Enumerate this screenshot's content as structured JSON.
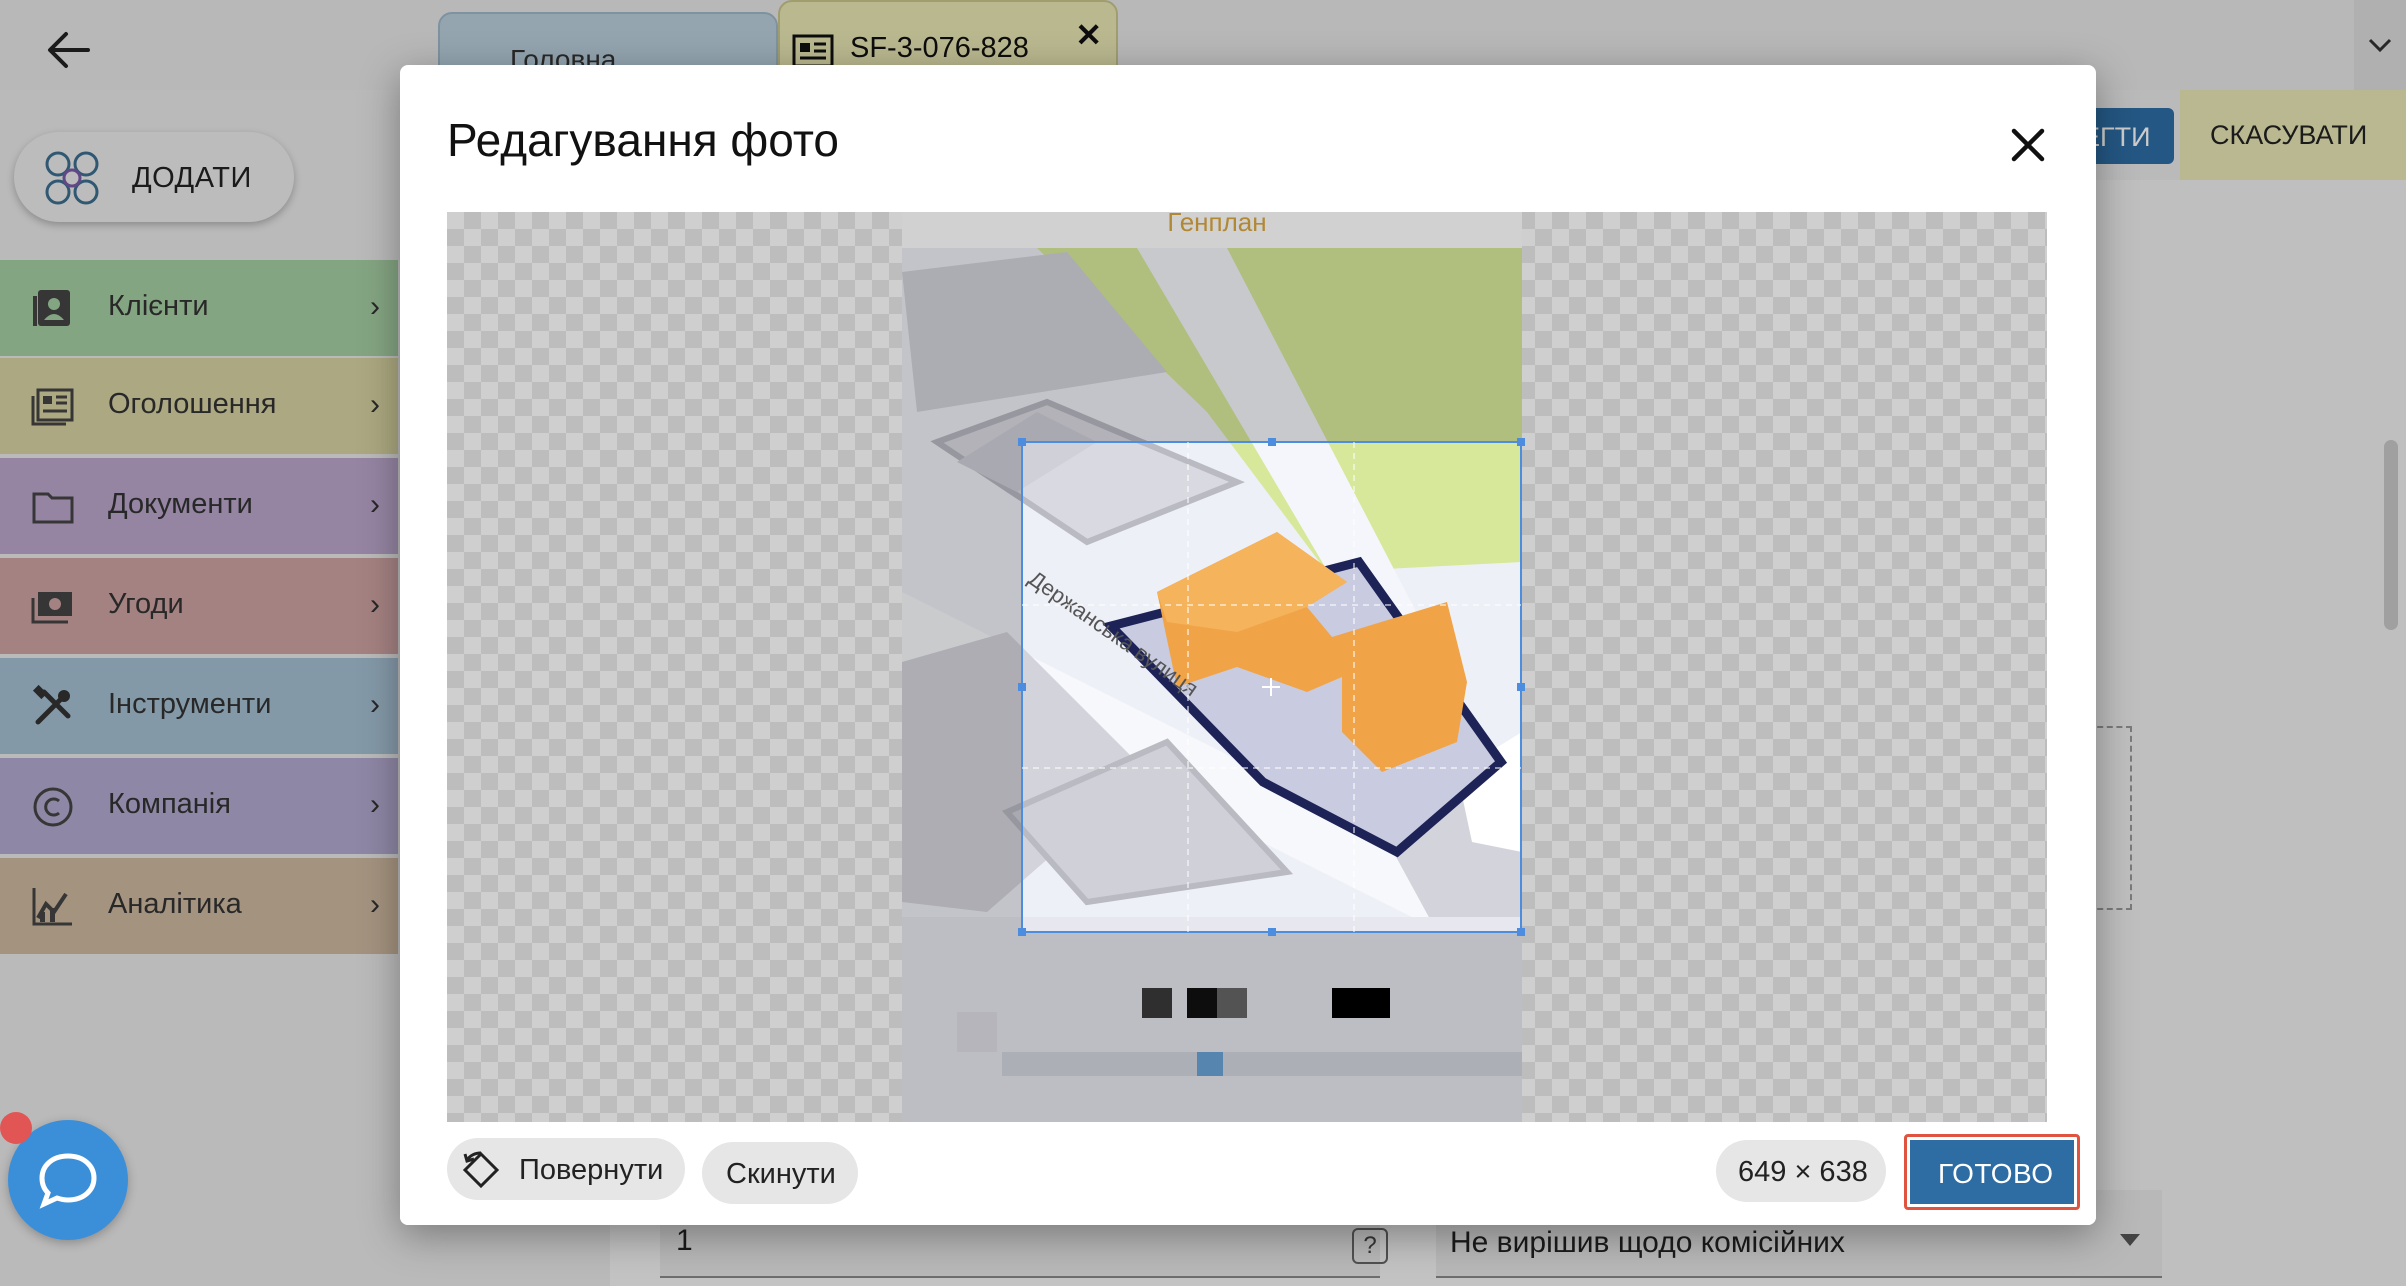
{
  "tabs": {
    "home_label": "Головна",
    "doc_label": "SF-3-076-828"
  },
  "add_button": {
    "label": "ДОДАТИ"
  },
  "sidebar": {
    "items": [
      {
        "label": "Клієнти",
        "icon": "contacts-icon",
        "color": "#a6cfa3"
      },
      {
        "label": "Оголошення",
        "icon": "listing-icon",
        "color": "#d7d3a2"
      },
      {
        "label": "Документи",
        "icon": "folder-icon",
        "color": "#bba7cc"
      },
      {
        "label": "Угоди",
        "icon": "money-icon",
        "color": "#cfa3a3"
      },
      {
        "label": "Інструменти",
        "icon": "tools-icon",
        "color": "#a6c0d3"
      },
      {
        "label": "Компанія",
        "icon": "copyright-icon",
        "color": "#b2a9cf"
      },
      {
        "label": "Аналітика",
        "icon": "analytics-icon",
        "color": "#cdb89f"
      }
    ]
  },
  "header_actions": {
    "save_label": "ЕГТИ",
    "cancel_label": "СКАСУВАТИ"
  },
  "form": {
    "quantity_value": "1",
    "help_label": "?",
    "commission_value": "Не вирішив щодо комісійних"
  },
  "modal": {
    "title": "Редагування фото",
    "street_label": "Держанська вулиця",
    "top_label": "Генплан",
    "rotate_label": "Повернути",
    "reset_label": "Скинути",
    "size_label": "649 × 638",
    "done_label": "ГОТОВО"
  },
  "colors": {
    "accent_blue": "#2e6da4",
    "highlight_red": "#e0533f",
    "building_orange": "#f0a447",
    "park_green": "#d7e89a"
  }
}
